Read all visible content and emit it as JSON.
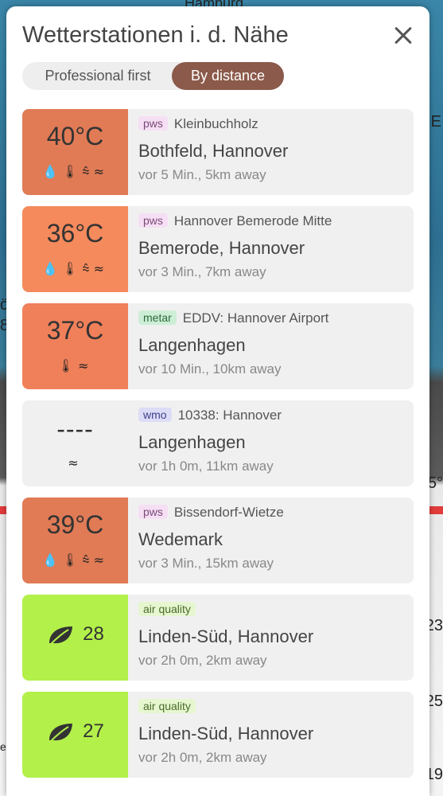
{
  "background": {
    "map_label_top": "Hamburg",
    "edge_labels": [
      "E",
      "ö",
      "8",
      "5°",
      "23",
      "25",
      "19",
      "eg"
    ]
  },
  "header": {
    "title": "Wetterstationen i. d. Nähe",
    "close_icon": "close-icon"
  },
  "sort_toggle": {
    "options": [
      "Professional first",
      "By distance"
    ],
    "selected": "By distance",
    "selected_color": "#8b5a4a"
  },
  "stations": [
    {
      "value": "40°C",
      "color": "#e07b56",
      "icons": [
        "drop-icon",
        "thermometer-icon",
        "pressure-icon",
        "wind-icon"
      ],
      "badge": "pws",
      "name": "Kleinbuchholz",
      "location": "Bothfeld, Hannover",
      "meta": "vor 5 Min., 5km away"
    },
    {
      "value": "36°C",
      "color": "#f58a5c",
      "icons": [
        "drop-icon",
        "thermometer-icon",
        "pressure-icon",
        "wind-icon"
      ],
      "badge": "pws",
      "name": "Hannover Bemerode Mitte",
      "location": "Bemerode, Hannover",
      "meta": "vor 3 Min., 7km away"
    },
    {
      "value": "37°C",
      "color": "#f0805a",
      "icons": [
        "thermometer-icon",
        "wind-icon"
      ],
      "badge": "metar",
      "name": "EDDV: Hannover Airport",
      "location": "Langenhagen",
      "meta": "vor 10 Min., 10km away"
    },
    {
      "value": "----",
      "color": "#f0f0f0",
      "icons": [
        "wind-icon"
      ],
      "badge": "wmo",
      "name": "10338: Hannover",
      "location": "Langenhagen",
      "meta": "vor 1h 0m, 11km away"
    },
    {
      "value": "39°C",
      "color": "#e07b56",
      "icons": [
        "drop-icon",
        "thermometer-icon",
        "pressure-icon",
        "wind-icon"
      ],
      "badge": "pws",
      "name": "Bissendorf-Wietze",
      "location": "Wedemark",
      "meta": "vor 3 Min., 15km away"
    },
    {
      "value": "28",
      "color": "#b3f04a",
      "icons": [
        "leaf-icon"
      ],
      "badge": "air quality",
      "name": "",
      "location": "Linden-Süd, Hannover",
      "meta": "vor 2h 0m, 2km away"
    },
    {
      "value": "27",
      "color": "#b3f04a",
      "icons": [
        "leaf-icon"
      ],
      "badge": "air quality",
      "name": "",
      "location": "Linden-Süd, Hannover",
      "meta": "vor 2h 0m, 2km away"
    }
  ]
}
